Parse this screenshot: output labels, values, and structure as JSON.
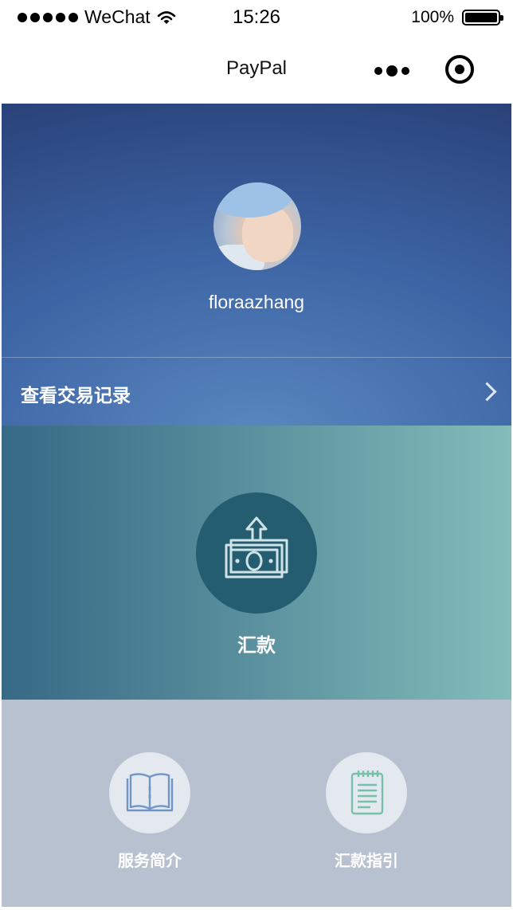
{
  "status_bar": {
    "carrier": "WeChat",
    "time": "15:26",
    "battery": "100%"
  },
  "nav": {
    "title": "PayPal"
  },
  "profile": {
    "username": "floraazhang",
    "history_label": "查看交易记录"
  },
  "transfer": {
    "label": "汇款"
  },
  "shortcuts": [
    {
      "label": "服务简介",
      "icon": "book-icon"
    },
    {
      "label": "汇款指引",
      "icon": "notepad-icon"
    }
  ],
  "colors": {
    "profile_gradient": [
      "#24386e",
      "#3d64a4",
      "#5a88c0"
    ],
    "transfer_gradient": [
      "#366a86",
      "#82bdbb"
    ],
    "transfer_circle": "#255d70",
    "bottom_bg": "#b7c1cf"
  }
}
